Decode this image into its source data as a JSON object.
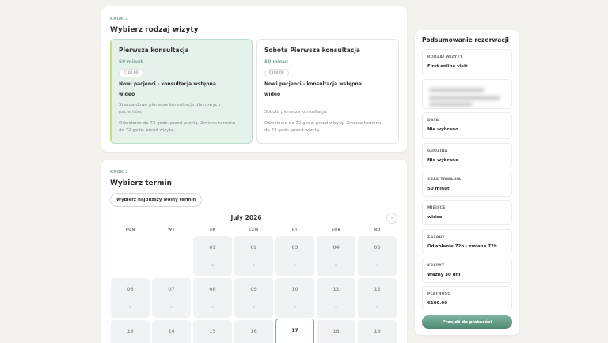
{
  "step1": {
    "label": "KROK 1",
    "title": "Wybierz rodzaj wizyty",
    "visits": [
      {
        "name": "Pierwsza konsultacja",
        "duration": "50 minut",
        "price": "€100.00",
        "subtitle": "Nowi pacjenci - konsultacja wstępna",
        "mode": "wideo",
        "description": "Standardowe pierwsze konsultacje dla nowych pacjentów.",
        "policy": "Odwołanie do 72 godz. przed wizytą. Zmiana terminu do 72 godz. przed wizytą."
      },
      {
        "name": "Sobota Pierwsza konsultacja",
        "duration": "50 minut",
        "price": "€200.00",
        "subtitle": "Nowi pacjenci - konsultacja wstępna",
        "mode": "wideo",
        "description": "Sobota pierwsza konsultacja.",
        "policy": "Odwołanie do 72 godz. przed wizytą. Zmiana terminu do 72 godz. przed wizytą."
      }
    ]
  },
  "step2": {
    "label": "KROK 2",
    "title": "Wybierz termin",
    "nearest_button": "Wybierz najbliższy wolny termin",
    "month": "July 2026",
    "next_icon": "chevron-right-icon",
    "weekdays": [
      "PON",
      "WT",
      "ŚR",
      "CZW",
      "PT",
      "SOB",
      "ND"
    ],
    "days": [
      "01",
      "02",
      "03",
      "04",
      "05",
      "06",
      "07",
      "08",
      "09",
      "10",
      "11",
      "12",
      "13",
      "14",
      "15",
      "16",
      "17",
      "18",
      "19"
    ],
    "today": "17"
  },
  "summary": {
    "title": "Podsumowanie rezerwacji",
    "items": [
      {
        "key": "RODZAJ WIZYTY",
        "value": "First online visit"
      },
      {
        "key": "DATA",
        "value": "Nie wybrano"
      },
      {
        "key": "GODZINA",
        "value": "Nie wybrano"
      },
      {
        "key": "CZAS TRWANIA",
        "value": "50 minut"
      },
      {
        "key": "MIEJSCE",
        "value": "wideo"
      },
      {
        "key": "ZASADY",
        "value": "Odwołanie 72h · zmiana 72h"
      },
      {
        "key": "KREDYT",
        "value": "Ważny 30 dni"
      },
      {
        "key": "PŁATNOŚĆ",
        "value": "€100.00"
      }
    ],
    "pay_button": "Przejdź do płatności"
  },
  "colors": {
    "accent": "#7fa898",
    "selected_bg": "#e5f2ea",
    "button_gradient_end": "#4f8a74"
  }
}
